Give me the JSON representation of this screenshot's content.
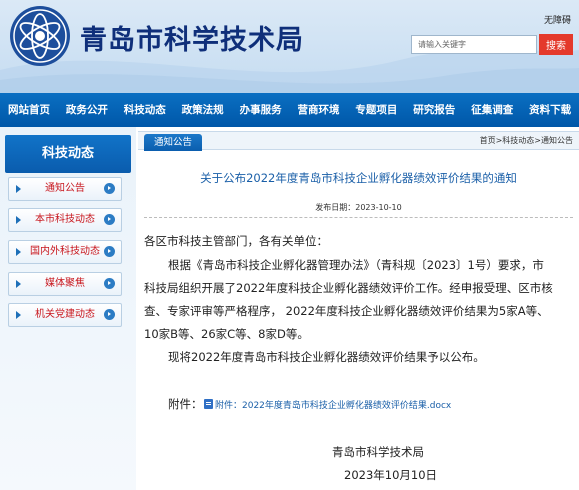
{
  "header": {
    "site_title": "青岛市科学技术局",
    "barrier_free": "无障碍",
    "search_placeholder": "请输入关键字",
    "search_button": "搜索"
  },
  "nav": [
    {
      "label": "网站首页"
    },
    {
      "label": "政务公开"
    },
    {
      "label": "科技动态"
    },
    {
      "label": "政策法规"
    },
    {
      "label": "办事服务"
    },
    {
      "label": "营商环境"
    },
    {
      "label": "专题项目"
    },
    {
      "label": "研究报告"
    },
    {
      "label": "征集调查"
    },
    {
      "label": "资料下载"
    }
  ],
  "sidebar": {
    "heading": "科技动态",
    "items": [
      {
        "label": "通知公告"
      },
      {
        "label": "本市科技动态"
      },
      {
        "label": "国内外科技动态"
      },
      {
        "label": "媒体聚焦"
      },
      {
        "label": "机关党建动态"
      }
    ]
  },
  "main": {
    "section_tab": "通知公告",
    "breadcrumb": "首页>科技动态>通知公告",
    "title": "关于公布2022年度青岛市科技企业孵化器绩效评价结果的通知",
    "pubdate": "发布日期：2023-10-10",
    "body": [
      "各区市科技主管部门，各有关单位：",
      "根据《青岛市科技企业孵化器管理办法》（青科规〔2023〕1号）要求，市",
      "科技局组织开展了2022年度科技企业孵化器绩效评价工作。经申报受理、区市核",
      "查、专家评审等严格程序， 2022年度科技企业孵化器绩效评价结果为5家A等、",
      "10家B等、26家C等、8家D等。",
      "现将2022年度青岛市科技企业孵化器绩效评价结果予以公布。"
    ],
    "attachment_label": "附件：",
    "attachment_link": "附件：2022年度青岛市科技企业孵化器绩效评价结果.docx",
    "signature_org": "青岛市科学技术局",
    "signature_date": "2023年10月10日"
  },
  "colors": {
    "nav_blue": "#0a6fc2",
    "title_navy": "#0f2f7a",
    "link_blue": "#1a5fa8",
    "search_red": "#e4392b",
    "sidebar_red_text": "#c8161d"
  },
  "icons": [
    "emblem-logo",
    "attachment-doc-icon",
    "arrow-icon"
  ]
}
